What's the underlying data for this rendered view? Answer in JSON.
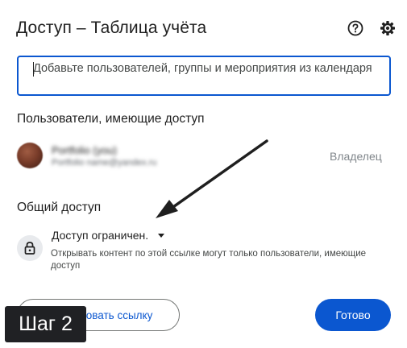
{
  "dialog": {
    "title": "Доступ – Таблица учёта",
    "help_icon": "help-circle-icon",
    "settings_icon": "gear-icon"
  },
  "add_people": {
    "placeholder": "Добавьте пользователей, группы и мероприятия из календаря"
  },
  "people_with_access": {
    "heading": "Пользователи, имеющие доступ",
    "users": [
      {
        "name": "Portfolio (you)",
        "email": "Portfolio name@yandex.ru",
        "role": "Владелец"
      }
    ]
  },
  "general_access": {
    "heading": "Общий доступ",
    "selected_option": "Доступ ограничен.",
    "description": "Открывать контент по этой ссылке могут только пользователи, имеющие доступ",
    "icon": "lock-icon"
  },
  "footer": {
    "copy_link_label": "Копировать ссылку",
    "done_label": "Готово"
  },
  "overlay": {
    "step_label": "Шаг 2"
  },
  "colors": {
    "accent": "#0b57d0",
    "text": "#1f1f1f",
    "muted": "#80868b",
    "badge_bg": "#202124"
  }
}
